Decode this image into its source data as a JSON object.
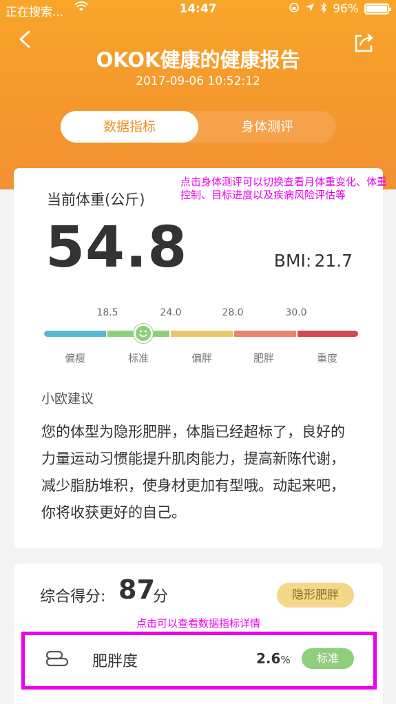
{
  "status_bar": {
    "carrier": "正在搜索...",
    "time": "14:47",
    "battery": "96%",
    "battery_level": 0.96
  },
  "header": {
    "title": "OKOK健康的健康报告",
    "datetime": "2017-09-06 10:52:12",
    "tabs": [
      {
        "label": "数据指标",
        "active": true
      },
      {
        "label": "身体测评",
        "active": false
      }
    ]
  },
  "annotations": {
    "tab_hint": "点击身体测评可以切换查看月体重变化、体重控制、目标进度以及疾病风险评估等",
    "detail_hint": "点击可以查看数据指标详情"
  },
  "weight_card": {
    "label": "当前体重(公斤)",
    "value": "54.8",
    "bmi_label": "BMI:",
    "bmi_value": "21.7",
    "scale_ticks": [
      "18.5",
      "24.0",
      "28.0",
      "30.0"
    ],
    "scale_labels": [
      "偏瘦",
      "标准",
      "偏胖",
      "肥胖",
      "重度"
    ],
    "scale_colors": [
      "#5bb8d2",
      "#8fcf7c",
      "#e6c86c",
      "#e8846c",
      "#d04a4e"
    ],
    "indicator_icon": "smiley-face-icon",
    "indicator_category": "标准",
    "advice_title": "小欧建议",
    "advice_text": "您的体型为隐形肥胖，体脂已经超标了，良好的力量运动习惯能提升肌肉能力，提高新陈代谢，减少脂肪堆积，使身材更加有型哦。动起来吧，你将收获更好的自己。"
  },
  "score_card": {
    "label": "综合得分:",
    "score": "87",
    "unit": "分",
    "body_type": "隐形肥胖",
    "metrics": [
      {
        "icon": "body-shape-icon",
        "name": "肥胖度",
        "value": "2.6",
        "unit": "%",
        "status": "标准"
      }
    ]
  }
}
